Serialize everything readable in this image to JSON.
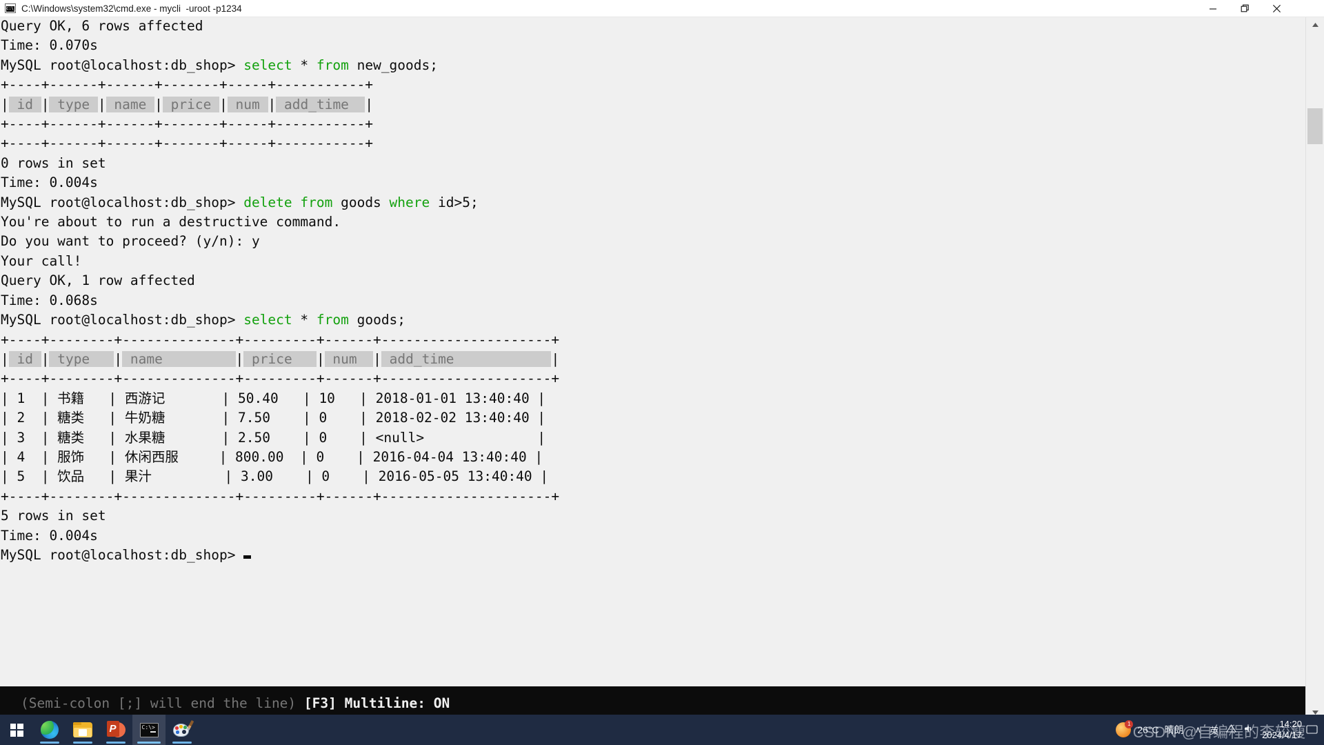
{
  "window": {
    "title": "C:\\Windows\\system32\\cmd.exe - mycli  -uroot -p1234",
    "icon": "cmd-icon",
    "controls": {
      "minimize": "—",
      "maximize": "❐",
      "close": "✕"
    }
  },
  "terminal": {
    "prompt": "MySQL root@localhost:db_shop>",
    "lines": [
      {
        "id": "l01",
        "text": "Query OK, 6 rows affected"
      },
      {
        "id": "l02",
        "text": "Time: 0.070s"
      },
      {
        "id": "l03",
        "prompt": "MySQL root@localhost:db_shop>",
        "kw1": " select",
        "plain1": " * ",
        "kw2": "from",
        "plain2": " new_goods;"
      },
      {
        "id": "l04",
        "text": "+----+------+------+-------+-----+-----------+"
      },
      {
        "id": "l05",
        "type": "header",
        "cells": [
          "id",
          "type",
          "name",
          "price",
          "num",
          "add_time"
        ]
      },
      {
        "id": "l06",
        "text": "+----+------+------+-------+-----+-----------+"
      },
      {
        "id": "l07",
        "text": "+----+------+------+-------+-----+-----------+"
      },
      {
        "id": "l08",
        "text": "0 rows in set"
      },
      {
        "id": "l09",
        "text": "Time: 0.004s"
      },
      {
        "id": "l10",
        "prompt": "MySQL root@localhost:db_shop>",
        "kw1": " delete from",
        "plain1": " goods ",
        "kw2": "where",
        "plain2": " id>5;"
      },
      {
        "id": "l11",
        "text": "You're about to run a destructive command."
      },
      {
        "id": "l12",
        "text": "Do you want to proceed? (y/n): y"
      },
      {
        "id": "l13",
        "text": "Your call!"
      },
      {
        "id": "l14",
        "text": "Query OK, 1 row affected"
      },
      {
        "id": "l15",
        "text": "Time: 0.068s"
      },
      {
        "id": "l16",
        "prompt": "MySQL root@localhost:db_shop>",
        "kw1": " select",
        "plain1": " * ",
        "kw2": "from",
        "plain2": " goods;"
      },
      {
        "id": "l17",
        "text": "+----+--------+--------------+---------+------+---------------------+"
      },
      {
        "id": "l18",
        "type": "header2",
        "cells": [
          "id",
          "type",
          "name",
          "price",
          "num",
          "add_time"
        ]
      },
      {
        "id": "l19",
        "text": "+----+--------+--------------+---------+------+---------------------+"
      },
      {
        "id": "l20",
        "text": "| 1  | 书籍   | 西游记       | 50.40   | 10   | 2018-01-01 13:40:40 |"
      },
      {
        "id": "l21",
        "text": "| 2  | 糖类   | 牛奶糖       | 7.50    | 0    | 2018-02-02 13:40:40 |"
      },
      {
        "id": "l22",
        "text": "| 3  | 糖类   | 水果糖       | 2.50    | 0    | <null>              |"
      },
      {
        "id": "l23",
        "text": "| 4  | 服饰   | 休闲西服     | 800.00  | 0    | 2016-04-04 13:40:40 |"
      },
      {
        "id": "l24",
        "text": "| 5  | 饮品   | 果汁         | 3.00    | 0    | 2016-05-05 13:40:40 |"
      },
      {
        "id": "l25",
        "text": "+----+--------+--------------+---------+------+---------------------+"
      },
      {
        "id": "l26",
        "text": "5 rows in set"
      },
      {
        "id": "l27",
        "text": "Time: 0.004s"
      },
      {
        "id": "l28",
        "prompt": "MySQL root@localhost:db_shop>",
        "cursor": true
      }
    ],
    "result_table": {
      "columns": [
        "id",
        "type",
        "name",
        "price",
        "num",
        "add_time"
      ],
      "rows": [
        [
          "1",
          "书籍",
          "西游记",
          "50.40",
          "10",
          "2018-01-01 13:40:40"
        ],
        [
          "2",
          "糖类",
          "牛奶糖",
          "7.50",
          "0",
          "2018-02-02 13:40:40"
        ],
        [
          "3",
          "糖类",
          "水果糖",
          "2.50",
          "0",
          "<null>"
        ],
        [
          "4",
          "服饰",
          "休闲西服",
          "800.00",
          "0",
          "2016-04-04 13:40:40"
        ],
        [
          "5",
          "饮品",
          "果汁",
          "3.00",
          "0",
          "2016-05-05 13:40:40"
        ]
      ],
      "footer": "5 rows in set",
      "time": "Time: 0.004s"
    },
    "colors": {
      "background": "#f0f0f0",
      "foreground": "#0c0c0c",
      "keyword": "#13a10e",
      "header_bg": "#cccccc",
      "header_fg": "#767676"
    }
  },
  "statusbar": {
    "hint": "(Semi-colon [;] will end the line) ",
    "multiline": "[F3] Multiline: ON",
    "background": "#0c0c0c"
  },
  "scrollbar": {
    "up_arrow": "▲",
    "down_arrow": "▼"
  },
  "taskbar": {
    "background": "#1f2b42",
    "items": [
      {
        "name": "start-button",
        "label": "Start"
      },
      {
        "name": "edge",
        "label": "Microsoft Edge"
      },
      {
        "name": "file-explorer",
        "label": "File Explorer"
      },
      {
        "name": "powerpoint",
        "label": "PowerPoint",
        "glyph": "P"
      },
      {
        "name": "command-prompt",
        "label": "Command Prompt"
      },
      {
        "name": "paint",
        "label": "Paint"
      }
    ],
    "tray": {
      "weather_temp": "26°C",
      "weather_desc": "晴朗",
      "weather_badge": "1",
      "chevron": "∧",
      "ime": "英",
      "clock_time": "14:20",
      "clock_date": "2024/4/17"
    },
    "watermark": "CSDN @自编程的李较瘦"
  }
}
